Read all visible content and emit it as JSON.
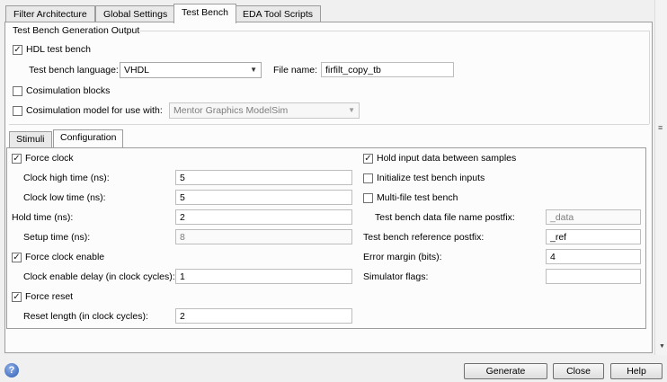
{
  "tabs": [
    "Filter Architecture",
    "Global Settings",
    "Test Bench",
    "EDA Tool Scripts"
  ],
  "group": {
    "title": "Test Bench Generation Output"
  },
  "hdl_test_bench": {
    "label": "HDL test bench",
    "checked": true
  },
  "language": {
    "label": "Test bench language:",
    "value": "VHDL"
  },
  "file_name": {
    "label": "File name:",
    "value": "firfilt_copy_tb"
  },
  "cosim_blocks": {
    "label": "Cosimulation blocks",
    "checked": false
  },
  "cosim_model": {
    "label": "Cosimulation model for use with:",
    "value": "Mentor Graphics ModelSim",
    "checked": false
  },
  "subtabs": [
    "Stimuli",
    "Configuration"
  ],
  "config": {
    "force_clock": {
      "label": "Force clock",
      "checked": true
    },
    "clock_high": {
      "label": "Clock high time (ns):",
      "value": "5"
    },
    "clock_low": {
      "label": "Clock low time (ns):",
      "value": "5"
    },
    "hold_time": {
      "label": "Hold time (ns):",
      "value": "2"
    },
    "setup_time": {
      "label": "Setup time (ns):",
      "value": "8"
    },
    "force_clock_enable": {
      "label": "Force clock enable",
      "checked": true
    },
    "clock_enable_delay": {
      "label": "Clock enable delay (in clock cycles):",
      "value": "1"
    },
    "force_reset": {
      "label": "Force reset",
      "checked": true
    },
    "reset_length": {
      "label": "Reset length (in clock cycles):",
      "value": "2"
    },
    "hold_input": {
      "label": "Hold input data between samples",
      "checked": true
    },
    "init_inputs": {
      "label": "Initialize test bench inputs",
      "checked": false
    },
    "multi_file": {
      "label": "Multi-file test bench",
      "checked": false
    },
    "data_postfix": {
      "label": "Test bench data file name postfix:",
      "value": "_data"
    },
    "ref_postfix": {
      "label": "Test bench reference postfix:",
      "value": "_ref"
    },
    "error_margin": {
      "label": "Error margin (bits):",
      "value": "4"
    },
    "simulator_flags": {
      "label": "Simulator flags:",
      "value": ""
    }
  },
  "buttons": {
    "generate": "Generate",
    "close": "Close",
    "help": "Help"
  },
  "help_glyph": "?",
  "check_glyph": "✓"
}
